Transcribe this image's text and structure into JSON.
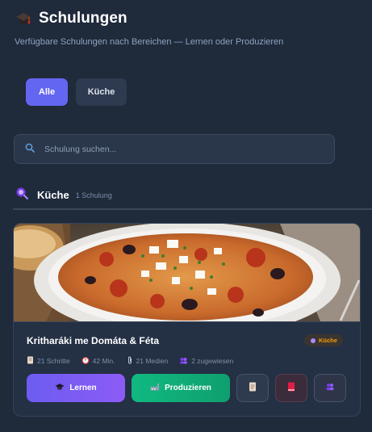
{
  "header": {
    "title": "Schulungen",
    "subtitle": "Verfügbare Schulungen nach Bereichen — Lernen oder Produzieren"
  },
  "filters": [
    {
      "label": "Alle",
      "active": true
    },
    {
      "label": "Küche",
      "active": false
    }
  ],
  "search": {
    "placeholder": "Schulung suchen...",
    "value": ""
  },
  "section": {
    "title": "Küche",
    "count": "1 Schulung"
  },
  "card": {
    "title": "Kritharáki me Domáta & Féta",
    "category": "Küche",
    "meta": {
      "steps": "21 Schritte",
      "duration": "42 Min.",
      "media": "21 Medien",
      "assigned": "2 zugewiesen"
    },
    "actions": {
      "learn": "Lernen",
      "produce": "Produzieren"
    }
  },
  "icons": {
    "header": "mortarboard-icon",
    "search": "search-icon",
    "section": "chef-hat-icon",
    "steps": "document-icon",
    "duration": "alarm-clock-icon",
    "media": "paperclip-icon",
    "assigned": "people-icon",
    "learn": "graduation-cap-icon",
    "produce": "factory-icon",
    "doc_button": "document-icon",
    "book_button": "book-icon",
    "users_button": "users-icon"
  },
  "colors": {
    "background": "#1f2a3b",
    "accent": "#6366f1",
    "produce": "#10b981",
    "category": "#f59e0b"
  }
}
